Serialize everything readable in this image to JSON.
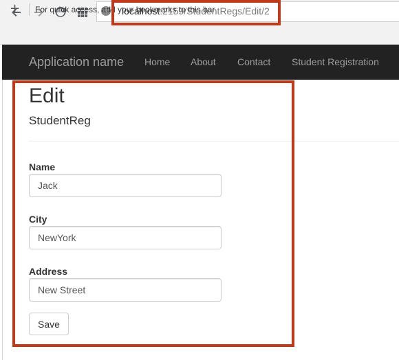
{
  "browser": {
    "back_icon": "arrow-left-icon",
    "forward_icon": "arrow-right-icon",
    "reload_icon": "reload-icon",
    "apps_icon": "apps-grid-icon",
    "url_host": "localhost",
    "url_path": ":2159/StudentRegs/Edit/2",
    "bookmarks_hint": "For quick access, add your bookmarks to this bar"
  },
  "navbar": {
    "brand": "Application name",
    "links": [
      "Home",
      "About",
      "Contact",
      "Student Registration"
    ]
  },
  "page": {
    "title": "Edit",
    "subtitle": "StudentReg"
  },
  "form": {
    "name_label": "Name",
    "name_value": "Jack",
    "city_label": "City",
    "city_value": "NewYork",
    "address_label": "Address",
    "address_value": "New Street",
    "save_label": "Save"
  },
  "colors": {
    "annotation": "#c0391b",
    "navbar_bg": "#222222",
    "navbar_text": "#9d9d9d"
  }
}
